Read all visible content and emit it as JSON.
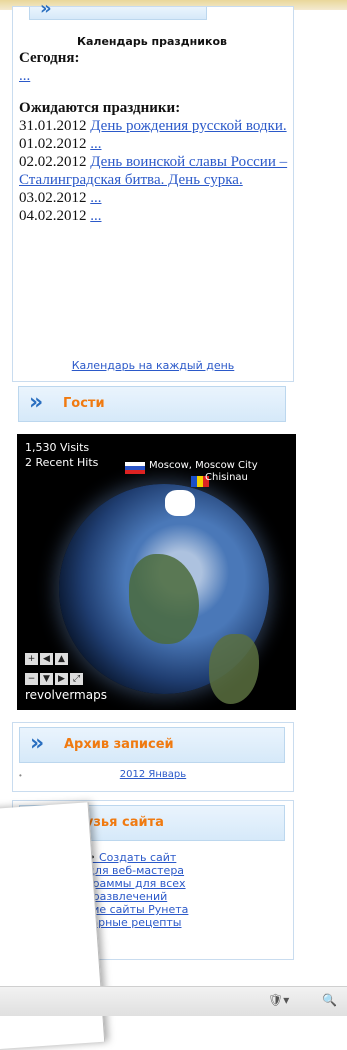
{
  "calendar": {
    "header_label": "Календарь праздников",
    "today_label": "Сегодня:",
    "today_link": "...",
    "upcoming_label": "Ожидаются праздники:",
    "entries": [
      {
        "date": "31.01.2012",
        "text": "День рождения русской водки."
      },
      {
        "date": "01.02.2012",
        "text": "..."
      },
      {
        "date": "02.02.2012",
        "text": "День воинской славы России – Сталинградская битва. День сурка."
      },
      {
        "date": "03.02.2012",
        "text": "..."
      },
      {
        "date": "04.02.2012",
        "text": "..."
      }
    ],
    "footer_link": "Календарь на каждый день"
  },
  "guests": {
    "title": "Гости",
    "visits": "1,530 Visits",
    "recent_hits": "2 Recent Hits",
    "location_1": "Moscow, Moscow City",
    "location_2": "Chisinau",
    "brand": "revolvermaps"
  },
  "archive": {
    "title": "Архив записей",
    "items": [
      "2012 Январь"
    ]
  },
  "friends": {
    "title": "Друзья сайта",
    "links": [
      "Создать сайт",
      "се для веб-мастера",
      "рограммы для всех",
      "ир развлечений",
      "ишие сайты Рунета",
      "инарные рецепты"
    ]
  },
  "colors": {
    "header_title": "#f07a10",
    "link": "#2b59c9",
    "panel_border": "#c9dcef"
  }
}
